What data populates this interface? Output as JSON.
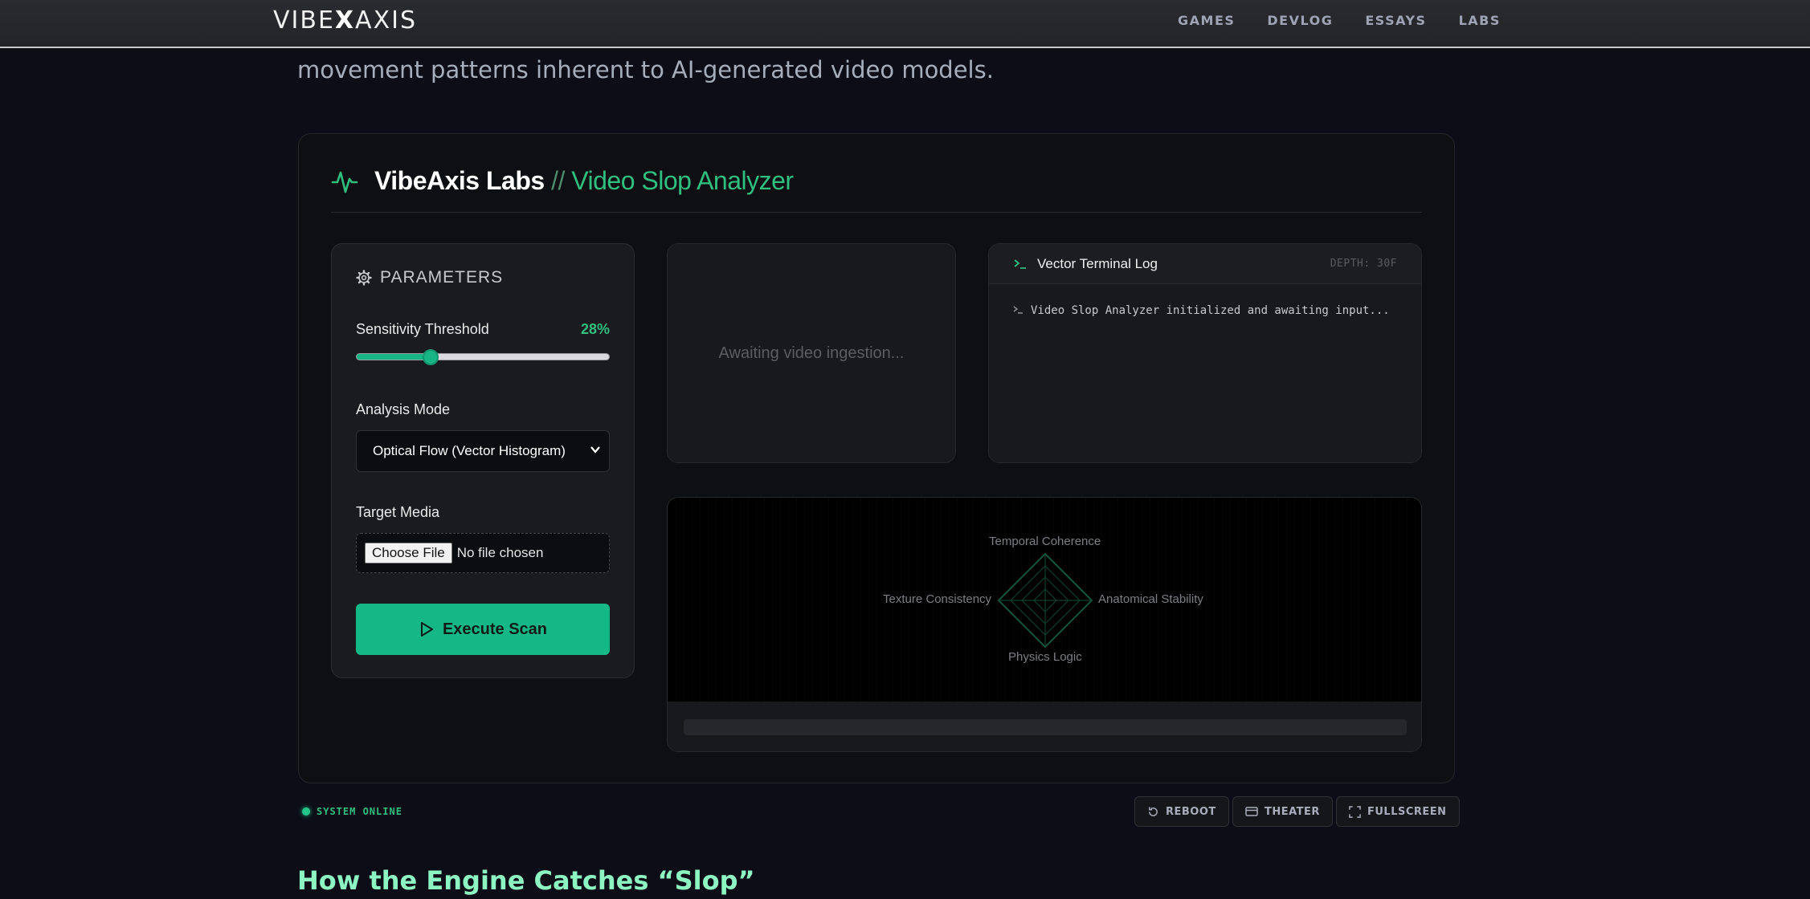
{
  "nav": {
    "logo_left": "VIBE",
    "logo_x": "X",
    "logo_right": "AXIS",
    "links": [
      "GAMES",
      "DEVLOG",
      "ESSAYS",
      "LABS"
    ]
  },
  "intro": {
    "text": "movement patterns inherent to AI-generated video models."
  },
  "card": {
    "brand": "VibeAxis Labs",
    "separator": "//",
    "name": "Video Slop Analyzer"
  },
  "params": {
    "heading": "PARAMETERS",
    "sensitivity_label": "Sensitivity Threshold",
    "sensitivity_value": "28%",
    "sensitivity_fraction": 0.28,
    "mode_label": "Analysis Mode",
    "mode_selected": "Optical Flow (Vector Histogram)",
    "media_label": "Target Media",
    "file_button": "Choose File",
    "file_status": "No file chosen",
    "execute_label": "Execute Scan"
  },
  "video": {
    "placeholder": "Awaiting video ingestion..."
  },
  "terminal": {
    "title": "Vector Terminal Log",
    "depth": "DEPTH: 30F",
    "log_line": "Video Slop Analyzer initialized and awaiting input..."
  },
  "radar": {
    "top": "Temporal Coherence",
    "right": "Anatomical Stability",
    "bottom": "Physics Logic",
    "left": "Texture Consistency"
  },
  "footer": {
    "status": "SYSTEM ONLINE",
    "reboot": "REBOOT",
    "theater": "THEATER",
    "fullscreen": "FULLSCREEN"
  },
  "section": {
    "title": "How the Engine Catches “Slop”"
  },
  "colors": {
    "accent": "#17b584",
    "background": "#0c0d17",
    "title_green": "#8df5c1"
  }
}
